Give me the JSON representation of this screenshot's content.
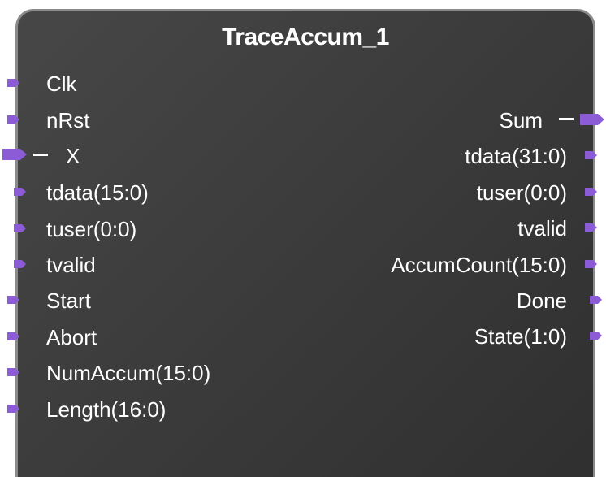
{
  "block": {
    "title": "TraceAccum_1"
  },
  "colors": {
    "port": "#8b5cd6",
    "body": "#3c3c3c",
    "border": "#8a8a8a",
    "text": "#ffffff"
  },
  "inputs": [
    {
      "label": "Clk",
      "icon": "port-arrow-icon"
    },
    {
      "label": "nRst",
      "icon": "port-arrow-icon"
    },
    {
      "label": "X",
      "icon": "bus-port-arrow-icon"
    },
    {
      "label": "tdata(15:0)",
      "icon": "port-arrow-icon"
    },
    {
      "label": "tuser(0:0)",
      "icon": "port-arrow-icon"
    },
    {
      "label": "tvalid",
      "icon": "port-arrow-icon"
    },
    {
      "label": "Start",
      "icon": "port-arrow-icon"
    },
    {
      "label": "Abort",
      "icon": "port-arrow-icon"
    },
    {
      "label": "NumAccum(15:0)",
      "icon": "port-arrow-icon"
    },
    {
      "label": "Length(16:0)",
      "icon": "port-arrow-icon"
    }
  ],
  "outputs": [
    {
      "label": "Sum",
      "icon": "bus-port-arrow-icon"
    },
    {
      "label": "tdata(31:0)",
      "icon": "port-arrow-icon"
    },
    {
      "label": "tuser(0:0)",
      "icon": "port-arrow-icon"
    },
    {
      "label": "tvalid",
      "icon": "port-arrow-icon"
    },
    {
      "label": "AccumCount(15:0)",
      "icon": "port-arrow-icon"
    },
    {
      "label": "Done",
      "icon": "port-arrow-icon"
    },
    {
      "label": "State(1:0)",
      "icon": "port-arrow-icon"
    }
  ]
}
